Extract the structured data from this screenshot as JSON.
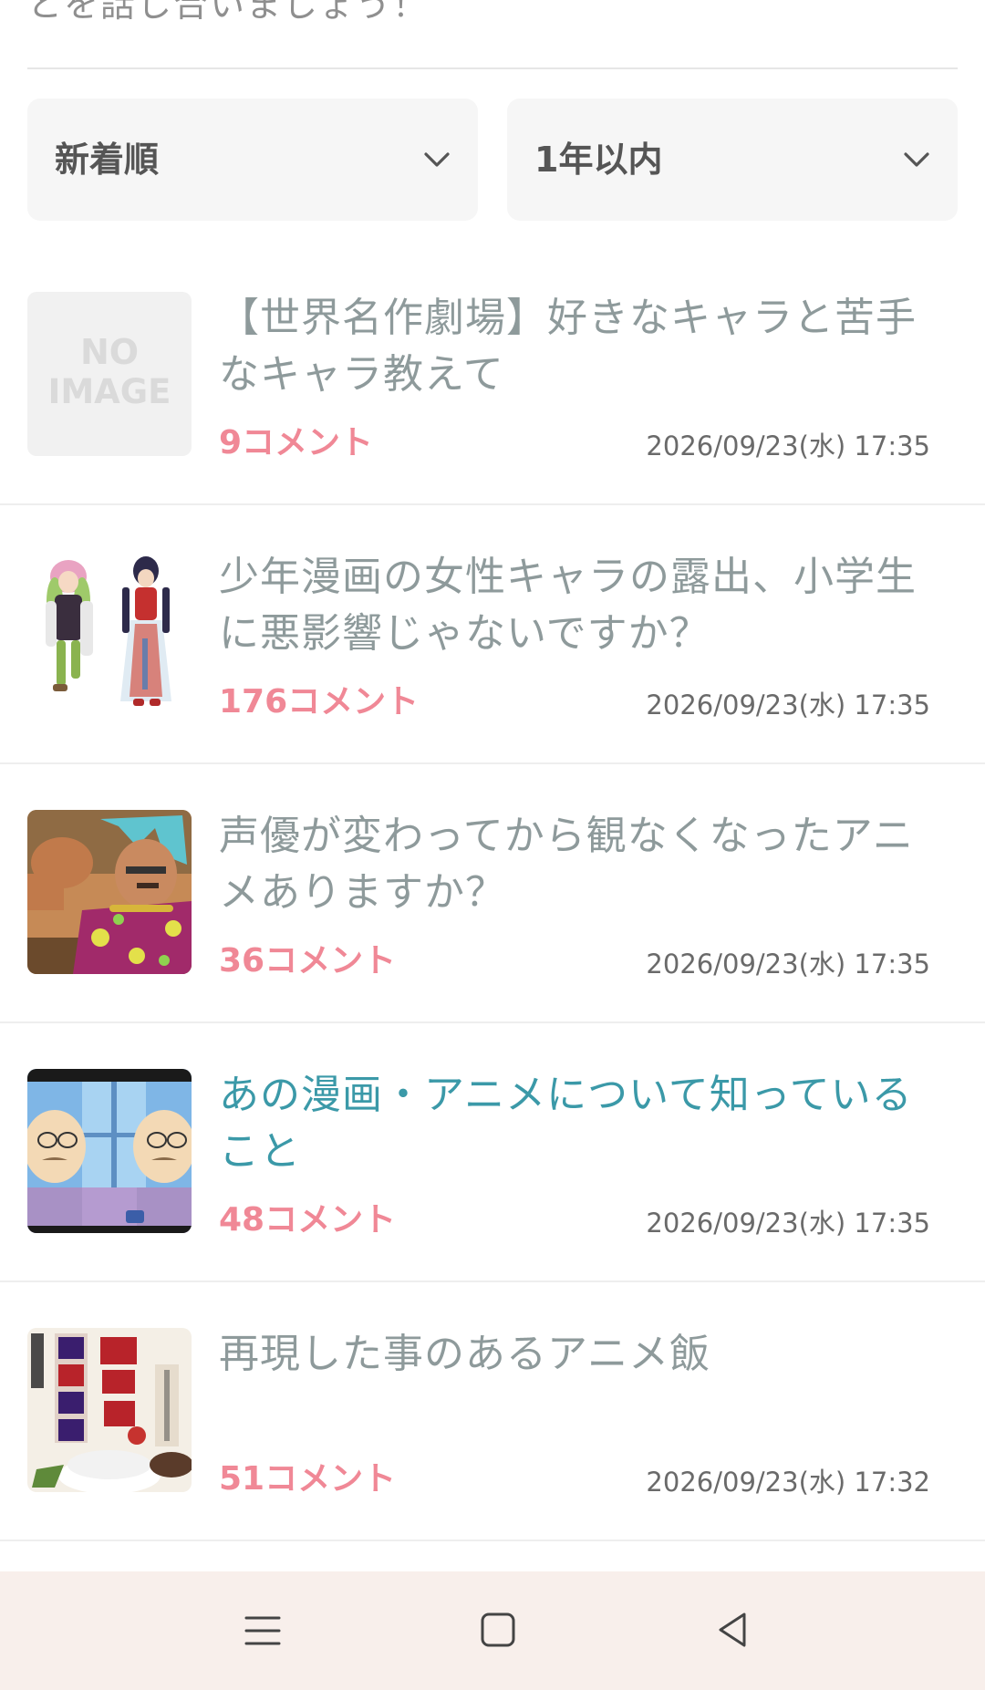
{
  "intro": {
    "tail_text": "とを話し合いましょう！"
  },
  "filters": {
    "sort": {
      "value": "新着順",
      "icon": "chevron-down-icon"
    },
    "period": {
      "value": "1年以内",
      "icon": "chevron-down-icon"
    }
  },
  "topics": [
    {
      "title": "【世界名作劇場】好きなキャラと苦手なキャラ教えて",
      "comments": "9コメント",
      "date": "2026/09/23(水) 17:35",
      "thumbnail": {
        "type": "no-image",
        "text_line1": "NO",
        "text_line2": "IMAGE"
      }
    },
    {
      "title": "少年漫画の女性キャラの露出、小学生に悪影響じゃないですか？",
      "comments": "176コメント",
      "date": "2026/09/23(水) 17:35",
      "thumbnail": {
        "type": "illustration"
      }
    },
    {
      "title": "声優が変わってから観なくなったアニメありますか？",
      "comments": "36コメント",
      "date": "2026/09/23(水) 17:35",
      "thumbnail": {
        "type": "illustration"
      }
    },
    {
      "title": "あの漫画・アニメについて知っていること",
      "comments": "48コメント",
      "date": "2026/09/23(水) 17:35",
      "thumbnail": {
        "type": "illustration"
      }
    },
    {
      "title": "再現した事のあるアニメ飯",
      "comments": "51コメント",
      "date": "2026/09/23(水) 17:32",
      "thumbnail": {
        "type": "book-cover"
      }
    }
  ],
  "navbar": {
    "icons": [
      "menu-icon",
      "home-icon",
      "back-icon"
    ]
  },
  "colors": {
    "title_gray": "#8e9a9b",
    "title_link": "#3b99a8",
    "comment_pink": "#f08896",
    "navbar_bg": "#f8efeb"
  }
}
